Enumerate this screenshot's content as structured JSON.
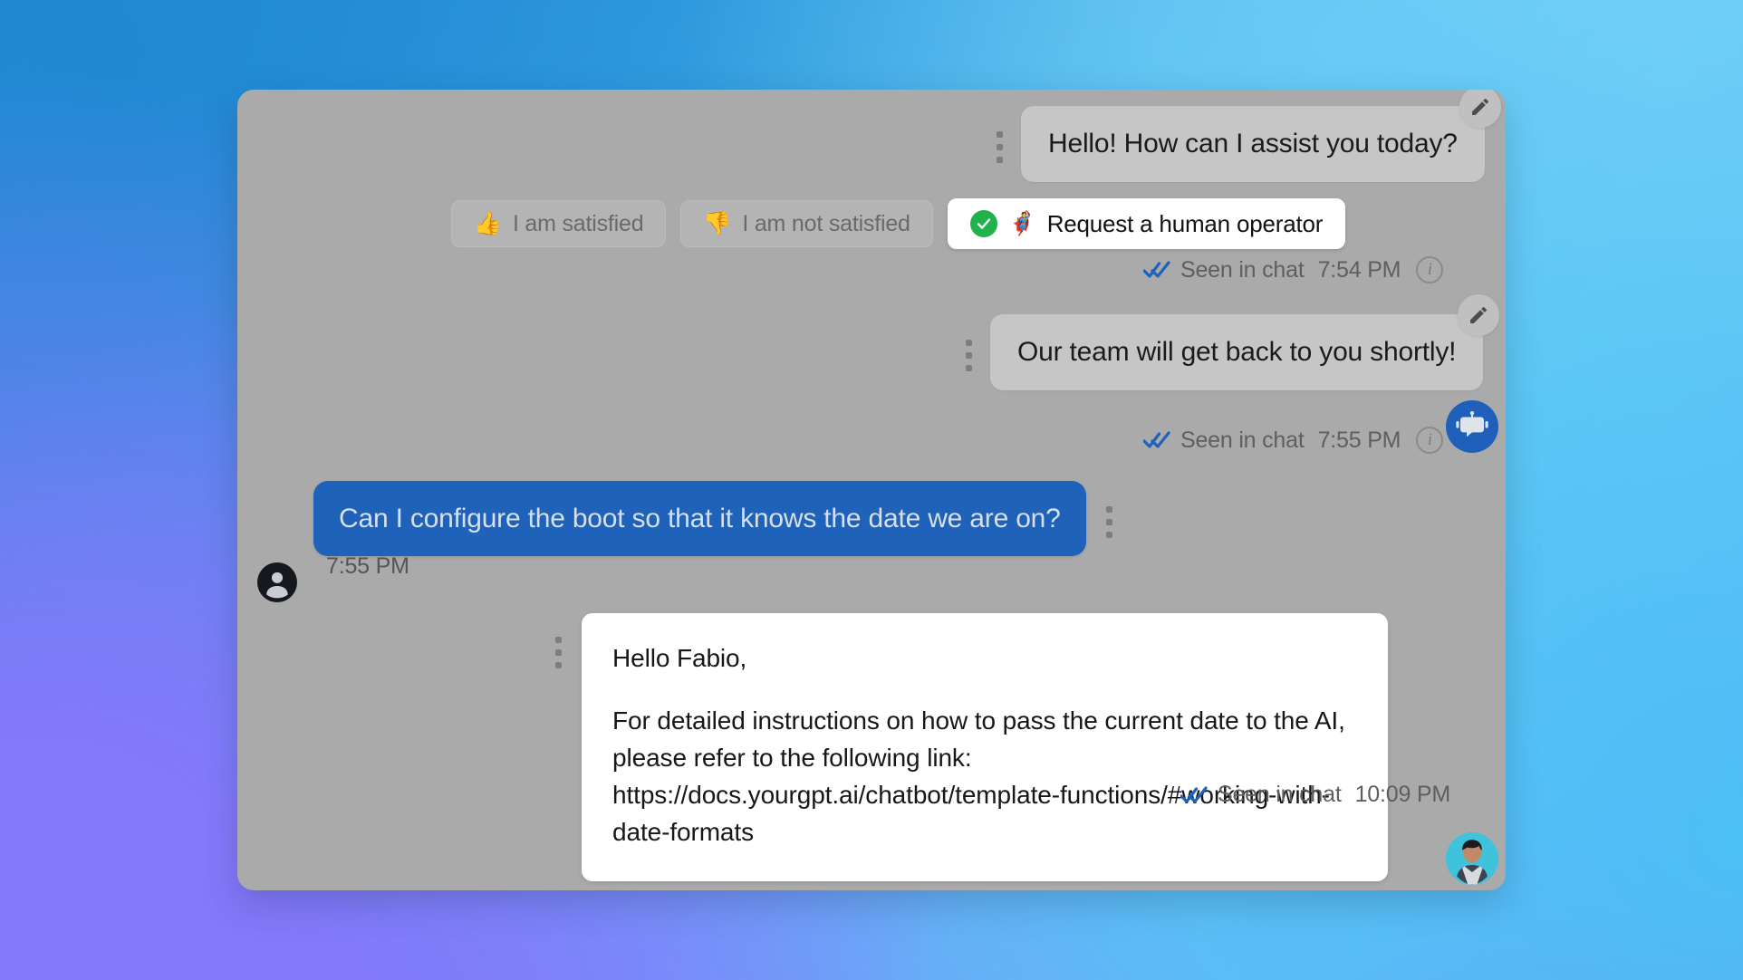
{
  "wallpaper": {
    "gradient_colors": [
      "#2189d4",
      "#3aa6e4",
      "#59c2f2",
      "#6ecdf5",
      "#4bc0f5",
      "#8478fb"
    ]
  },
  "panel": {
    "background": "#aaaaab"
  },
  "colors": {
    "bot_bubble": "#c6c6c6",
    "user_bubble": "#1e62ba",
    "agent_bubble": "#ffffff",
    "seen_check": "#1e62ba",
    "success_green": "#21b24c",
    "bot_avatar": "#1f61ba"
  },
  "conversation": {
    "messages": [
      {
        "id": "bot-greeting",
        "sender": "bot",
        "text": "Hello! How can I assist you today?",
        "status": "Seen in chat",
        "time": "7:54 PM",
        "menu_icon": "kebab-menu-icon",
        "edit_icon": "pencil-icon",
        "info_icon": "info-icon"
      },
      {
        "id": "bot-followup",
        "sender": "bot",
        "text": "Our team will get back to you shortly!",
        "status": "Seen in chat",
        "time": "7:55 PM",
        "menu_icon": "kebab-menu-icon",
        "edit_icon": "pencil-icon",
        "info_icon": "info-icon"
      },
      {
        "id": "user-question",
        "sender": "user",
        "text": "Can I configure the boot so that it knows the date we are on?",
        "time": "7:55 PM",
        "menu_icon": "kebab-menu-icon"
      },
      {
        "id": "agent-reply",
        "sender": "agent",
        "paragraph_1": "Hello Fabio,",
        "paragraph_2": "For detailed instructions on how to pass the current date to the AI, please refer to the following link: https://docs.yourgpt.ai/chatbot/template-functions/#working-with-date-formats",
        "status": "Seen in chat",
        "time": "10:09 PM",
        "menu_icon": "kebab-menu-icon"
      }
    ],
    "quick_replies": [
      {
        "id": "satisfied",
        "emoji": "👍",
        "label": "I am satisfied",
        "state": "inactive"
      },
      {
        "id": "not-satisfied",
        "emoji": "👎",
        "label": "I am not satisfied",
        "state": "inactive"
      },
      {
        "id": "human-operator",
        "emoji": "🦸",
        "label": "Request a human operator",
        "state": "selected"
      }
    ]
  }
}
